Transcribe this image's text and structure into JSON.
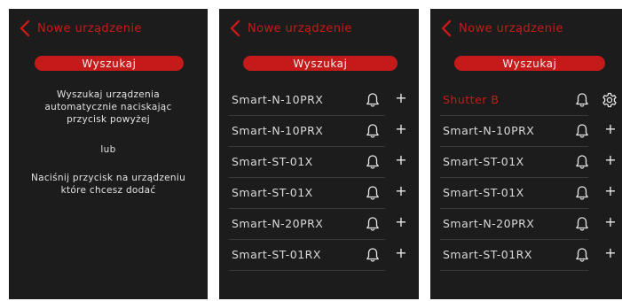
{
  "colors": {
    "accent": "#c51a1a",
    "background": "#1c1c1c",
    "text": "#d9d9d9",
    "divider": "#3a3a3a"
  },
  "screens": [
    {
      "title": "Nowe urządzenie",
      "search_label": "Wyszukaj",
      "info_line1": "Wyszukaj urządzenia",
      "info_line2": "automatycznie naciskając",
      "info_line3": "przycisk powyżej",
      "or_label": "lub",
      "info_line4": "Naciśnij przycisk na urządzeniu",
      "info_line5": "które chcesz dodać"
    },
    {
      "title": "Nowe urządzenie",
      "search_label": "Wyszukaj",
      "devices": [
        {
          "name": "Smart-N-10PRX",
          "icon": "bell-icon",
          "action": "plus-icon"
        },
        {
          "name": "Smart-N-10PRX",
          "icon": "bell-icon",
          "action": "plus-icon"
        },
        {
          "name": "Smart-ST-01X",
          "icon": "bell-icon",
          "action": "plus-icon"
        },
        {
          "name": "Smart-ST-01X",
          "icon": "bell-icon",
          "action": "plus-icon"
        },
        {
          "name": "Smart-N-20PRX",
          "icon": "bell-icon",
          "action": "plus-icon"
        },
        {
          "name": "Smart-ST-01RX",
          "icon": "bell-icon",
          "action": "plus-icon"
        }
      ]
    },
    {
      "title": "Nowe urządzenie",
      "search_label": "Wyszukaj",
      "devices": [
        {
          "name": "Shutter B",
          "icon": "bell-icon",
          "action": "gear-icon",
          "added": true
        },
        {
          "name": "Smart-N-10PRX",
          "icon": "bell-icon",
          "action": "plus-icon"
        },
        {
          "name": "Smart-ST-01X",
          "icon": "bell-icon",
          "action": "plus-icon"
        },
        {
          "name": "Smart-ST-01X",
          "icon": "bell-icon",
          "action": "plus-icon"
        },
        {
          "name": "Smart-N-20PRX",
          "icon": "bell-icon",
          "action": "plus-icon"
        },
        {
          "name": "Smart-ST-01RX",
          "icon": "bell-icon",
          "action": "plus-icon"
        }
      ]
    }
  ]
}
